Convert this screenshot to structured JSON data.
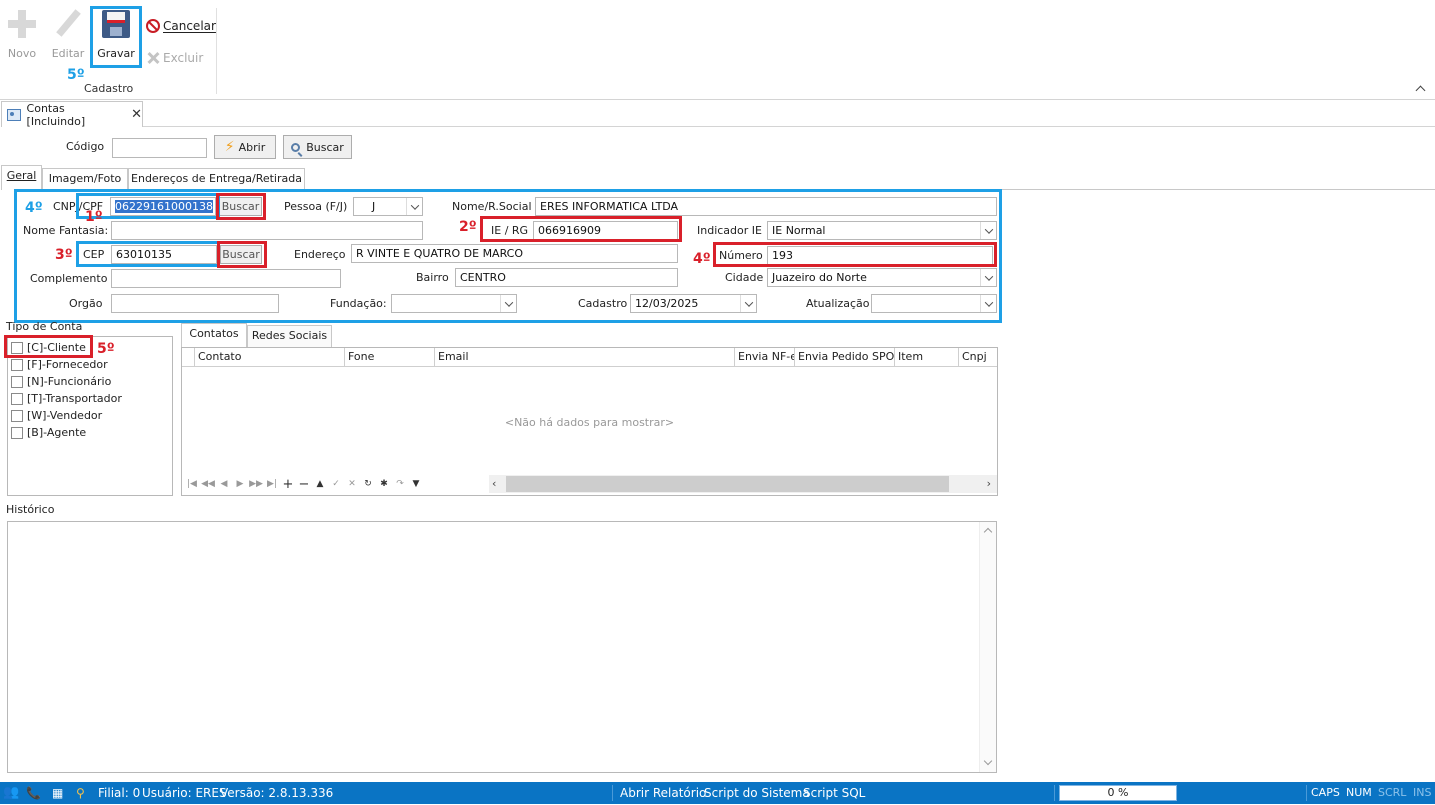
{
  "ribbon": {
    "novo": "Novo",
    "editar": "Editar",
    "gravar": "Gravar",
    "cancelar": "Cancelar",
    "excluir": "Excluir",
    "group_label": "Cadastro",
    "step_gravar": "5º"
  },
  "doc_tab": {
    "title": "Contas [Incluindo]"
  },
  "codigo": {
    "label": "Código",
    "value": "",
    "abrir": "Abrir",
    "buscar": "Buscar"
  },
  "tabs": [
    "Geral",
    "Imagem/Foto",
    "Endereços de Entrega/Retirada"
  ],
  "form": {
    "cnpj_label": "CNPJ/CPF",
    "cnpj_value": "06229161000138",
    "cnpj_buscar": "Buscar",
    "pessoa_label": "Pessoa (F/J)",
    "pessoa_value": "J",
    "nome_label": "Nome/R.Social",
    "nome_value": "ERES INFORMATICA LTDA",
    "fantasia_label": "Nome Fantasia:",
    "fantasia_value": "",
    "ie_label": "IE / RG",
    "ie_value": "066916909",
    "indicador_label": "Indicador IE",
    "indicador_value": "IE Normal",
    "cep_label": "CEP",
    "cep_value": "63010135",
    "cep_buscar": "Buscar",
    "endereco_label": "Endereço",
    "endereco_value": "R VINTE E QUATRO DE MARCO",
    "numero_label": "Número",
    "numero_value": "193",
    "complemento_label": "Complemento",
    "complemento_value": "",
    "bairro_label": "Bairro",
    "bairro_value": "CENTRO",
    "cidade_label": "Cidade",
    "cidade_value": "Juazeiro do Norte",
    "orgao_label": "Orgão",
    "orgao_value": "",
    "fundacao_label": "Fundação:",
    "fundacao_value": "",
    "cadastro_label": "Cadastro",
    "cadastro_value": "12/03/2025",
    "atualizacao_label": "Atualização",
    "atualizacao_value": ""
  },
  "steps": {
    "s1": "1º",
    "s2": "2º",
    "s3": "3º",
    "s4a": "4º",
    "s4b": "4º",
    "s5": "5º"
  },
  "tipo_conta": {
    "title": "Tipo de Conta",
    "items": [
      "[C]-Cliente",
      "[F]-Fornecedor",
      "[N]-Funcionário",
      "[T]-Transportador",
      "[W]-Vendedor",
      "[B]-Agente"
    ]
  },
  "sub_tabs": [
    "Contatos",
    "Redes Sociais"
  ],
  "grid": {
    "columns": [
      "Contato",
      "Fone",
      "Email",
      "Envia NF-e",
      "Envia Pedido SPO",
      "Item",
      "Cnpj"
    ],
    "empty_text": "<Não há dados para mostrar>"
  },
  "historico": {
    "label": "Histórico"
  },
  "statusbar": {
    "filial": "Filial: 0",
    "usuario": "Usuário: ERES",
    "versao": "Versão: 2.8.13.336",
    "abrir_relatorio": "Abrir Relatório",
    "script_sistema": "Script do Sistema",
    "script_sql": "Script SQL",
    "progress": "0 %",
    "caps": "CAPS",
    "num": "NUM",
    "scrl": "SCRL",
    "ins": "INS"
  },
  "colors": {
    "accent_blue": "#1ea0e6",
    "mark_red": "#d9202a",
    "statusbar_bg": "#0a74c4"
  }
}
